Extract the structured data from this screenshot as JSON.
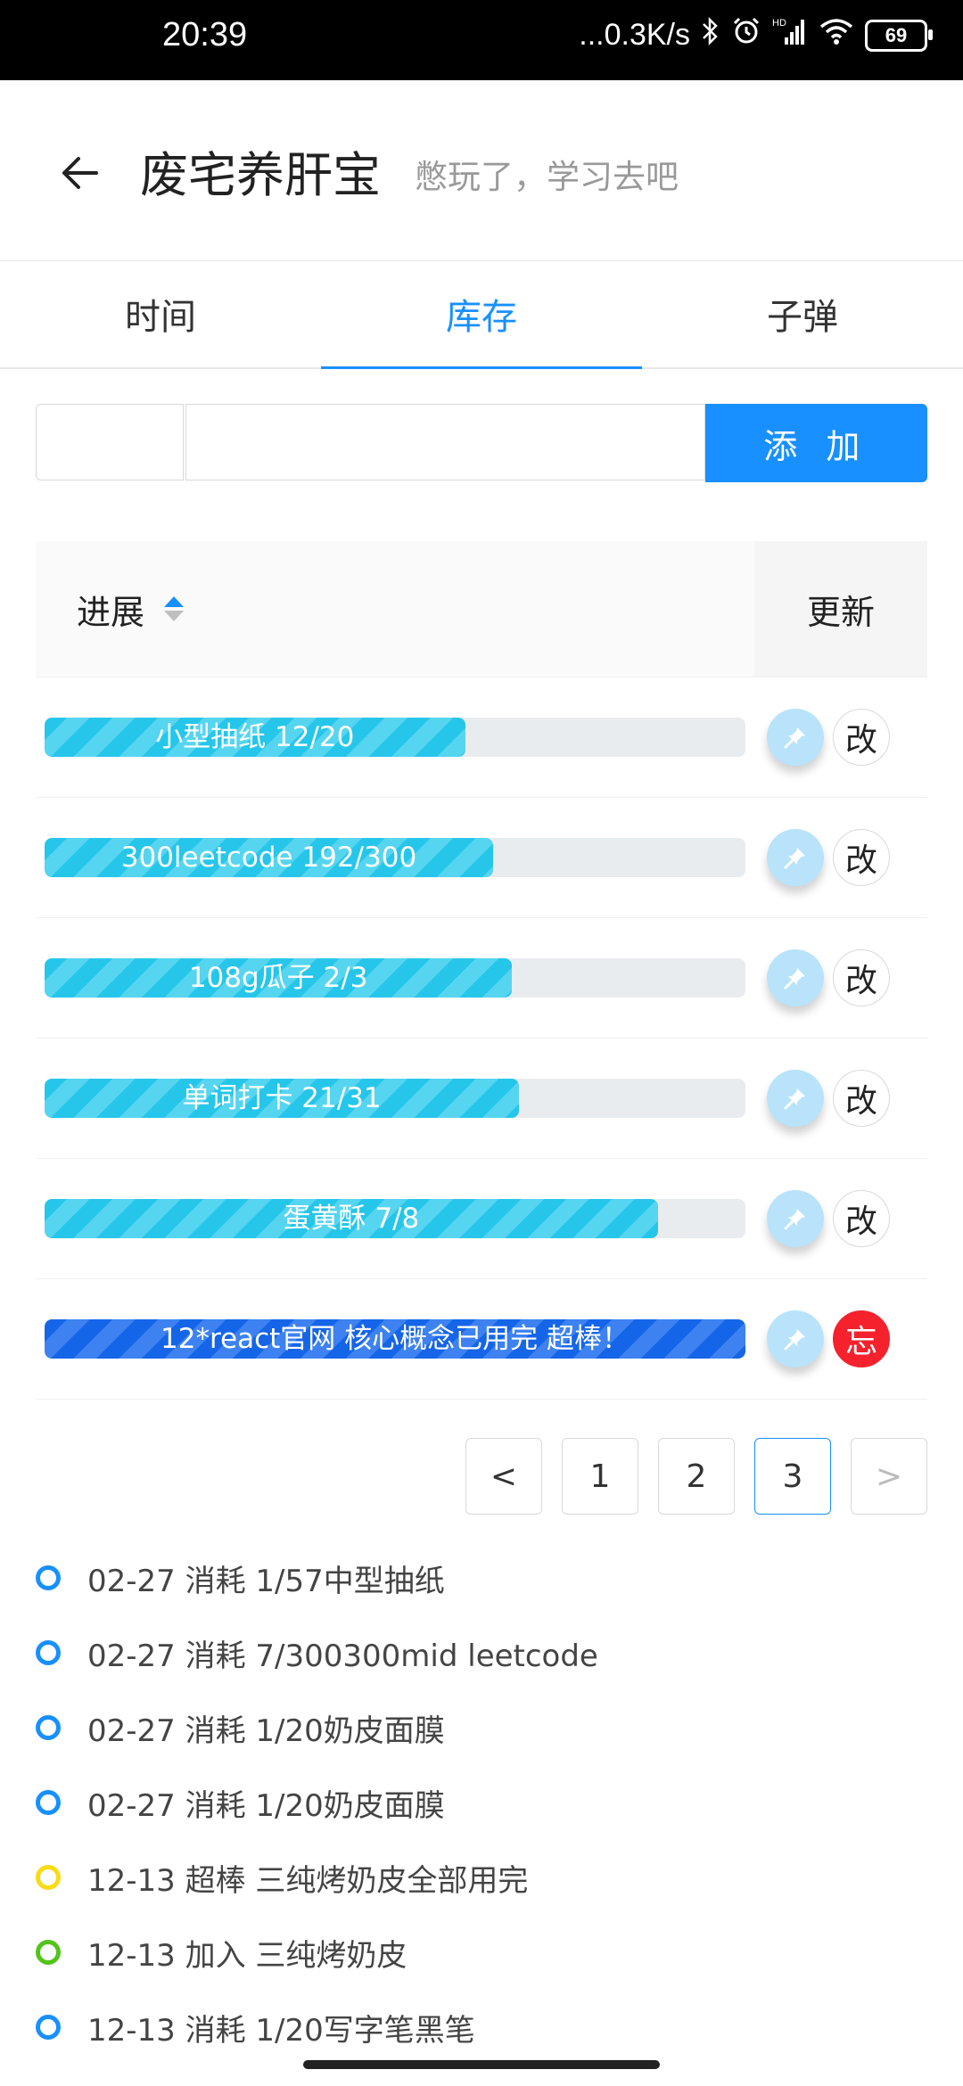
{
  "status_bar": {
    "time": "20:39",
    "network": "...0.3K/s",
    "signal_label": "HD",
    "battery": "69"
  },
  "header": {
    "title": "废宅养肝宝",
    "subtitle": "憋玩了，学习去吧"
  },
  "tabs": [
    {
      "label": "时间",
      "active": false
    },
    {
      "label": "库存",
      "active": true
    },
    {
      "label": "子弹",
      "active": false
    }
  ],
  "form": {
    "add_label": "添 加",
    "qty_value": "",
    "name_value": ""
  },
  "table": {
    "col_progress": "进展",
    "col_update": "更新",
    "rows": [
      {
        "label": "小型抽纸 12/20",
        "progress": 0.6,
        "action": "改",
        "done": false
      },
      {
        "label": "300leetcode 192/300",
        "progress": 0.64,
        "action": "改",
        "done": false
      },
      {
        "label": "108g瓜子 2/3",
        "progress": 0.667,
        "action": "改",
        "done": false
      },
      {
        "label": "单词打卡 21/31",
        "progress": 0.677,
        "action": "改",
        "done": false
      },
      {
        "label": "蛋黄酥 7/8",
        "progress": 0.875,
        "action": "改",
        "done": false
      },
      {
        "label": "12*react官网 核心概念已用完 超棒！",
        "progress": 1.0,
        "action": "忘",
        "done": true
      }
    ]
  },
  "pagination": {
    "prev": "<",
    "pages": [
      "1",
      "2",
      "3"
    ],
    "current": "3",
    "next": ">"
  },
  "timeline": [
    {
      "text": "02-27 消耗 1/57中型抽纸",
      "color": "#1890ff"
    },
    {
      "text": "02-27 消耗 7/300300mid leetcode",
      "color": "#1890ff"
    },
    {
      "text": "02-27 消耗 1/20奶皮面膜",
      "color": "#1890ff"
    },
    {
      "text": "02-27 消耗 1/20奶皮面膜",
      "color": "#1890ff"
    },
    {
      "text": "12-13 超棒 三纯烤奶皮全部用完",
      "color": "#fadb14"
    },
    {
      "text": "12-13 加入 三纯烤奶皮",
      "color": "#52c41a"
    },
    {
      "text": "12-13 消耗 1/20写字笔黑笔",
      "color": "#1890ff"
    }
  ],
  "icons": {
    "back": "arrow-left-icon",
    "pin": "pin-icon",
    "sort": "sort-icon"
  },
  "colors": {
    "accent": "#1890ff",
    "progress": "#26c6ea",
    "progress_done": "#1565e8",
    "danger": "#f5222d"
  }
}
